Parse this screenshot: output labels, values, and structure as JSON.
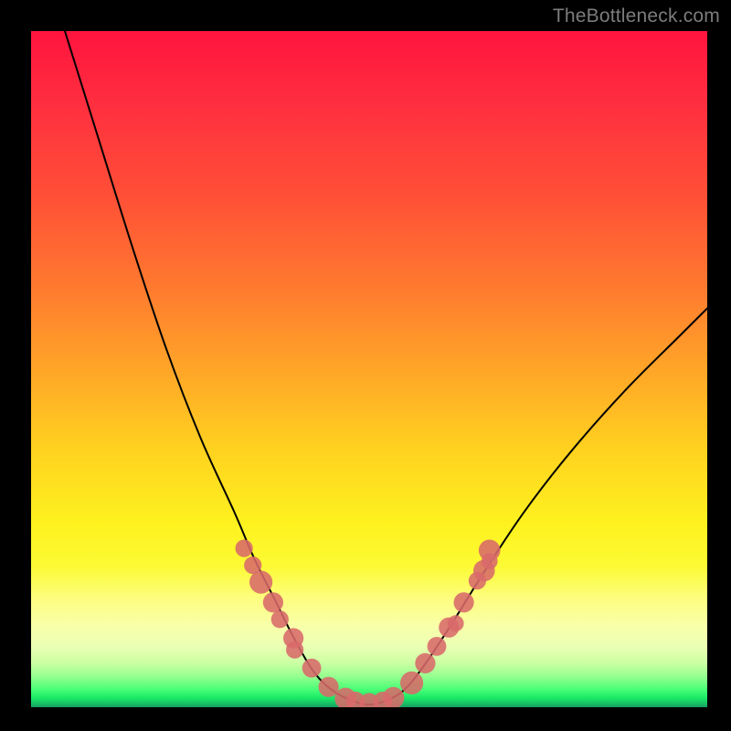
{
  "watermark": "TheBottleneck.com",
  "chart_data": {
    "type": "line",
    "title": "",
    "xlabel": "",
    "ylabel": "",
    "xlim": [
      0,
      100
    ],
    "ylim": [
      0,
      100
    ],
    "series": [
      {
        "name": "bottleneck-curve",
        "x": [
          5,
          10,
          15,
          20,
          25,
          30,
          33,
          36,
          39,
          42,
          45,
          48,
          50,
          52,
          55,
          58,
          62,
          67,
          73,
          80,
          88,
          96,
          100
        ],
        "values": [
          100,
          84,
          68,
          53,
          40,
          29,
          22,
          16,
          10,
          5,
          2.2,
          0.8,
          0.4,
          0.8,
          2.4,
          6,
          12,
          20,
          29,
          38,
          47,
          55,
          59
        ]
      }
    ],
    "markers": {
      "name": "marker-dots",
      "color": "#d86a6a",
      "points": [
        {
          "x": 31.5,
          "y": 23.5,
          "r": 1.3
        },
        {
          "x": 32.8,
          "y": 21.0,
          "r": 1.3
        },
        {
          "x": 34.0,
          "y": 18.5,
          "r": 1.7
        },
        {
          "x": 35.8,
          "y": 15.5,
          "r": 1.5
        },
        {
          "x": 36.8,
          "y": 13.0,
          "r": 1.3
        },
        {
          "x": 38.8,
          "y": 10.2,
          "r": 1.5
        },
        {
          "x": 39.0,
          "y": 8.5,
          "r": 1.3
        },
        {
          "x": 41.5,
          "y": 5.8,
          "r": 1.4
        },
        {
          "x": 44.0,
          "y": 3.0,
          "r": 1.5
        },
        {
          "x": 46.5,
          "y": 1.3,
          "r": 1.6
        },
        {
          "x": 48.0,
          "y": 0.9,
          "r": 1.4
        },
        {
          "x": 50.0,
          "y": 0.7,
          "r": 1.4
        },
        {
          "x": 52.0,
          "y": 0.9,
          "r": 1.4
        },
        {
          "x": 53.6,
          "y": 1.4,
          "r": 1.6
        },
        {
          "x": 56.3,
          "y": 3.6,
          "r": 1.7
        },
        {
          "x": 58.3,
          "y": 6.5,
          "r": 1.5
        },
        {
          "x": 60.0,
          "y": 9.0,
          "r": 1.4
        },
        {
          "x": 61.8,
          "y": 11.8,
          "r": 1.5
        },
        {
          "x": 62.8,
          "y": 12.4,
          "r": 1.2
        },
        {
          "x": 64.0,
          "y": 15.5,
          "r": 1.5
        },
        {
          "x": 66.0,
          "y": 18.7,
          "r": 1.3
        },
        {
          "x": 67.0,
          "y": 20.2,
          "r": 1.6
        },
        {
          "x": 67.8,
          "y": 23.2,
          "r": 1.6
        },
        {
          "x": 67.8,
          "y": 21.6,
          "r": 1.2
        }
      ]
    },
    "grid": false,
    "legend": false
  }
}
